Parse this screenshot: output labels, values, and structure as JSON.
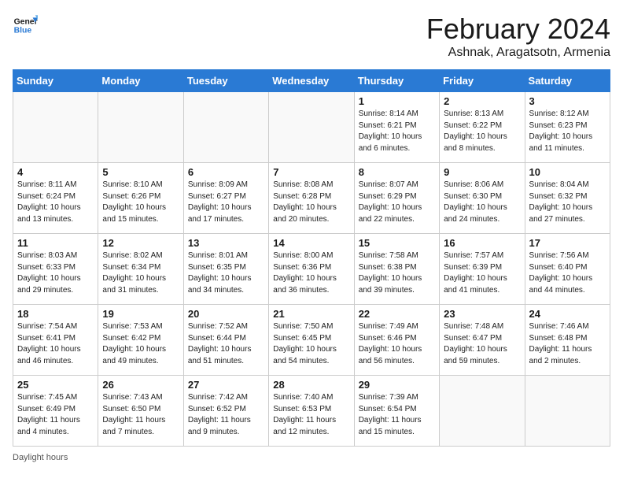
{
  "header": {
    "logo_line1": "General",
    "logo_line2": "Blue",
    "title": "February 2024",
    "subtitle": "Ashnak, Aragatsotn, Armenia"
  },
  "days_of_week": [
    "Sunday",
    "Monday",
    "Tuesday",
    "Wednesday",
    "Thursday",
    "Friday",
    "Saturday"
  ],
  "footer": {
    "daylight_label": "Daylight hours"
  },
  "weeks": [
    {
      "days": [
        {
          "num": "",
          "info": ""
        },
        {
          "num": "",
          "info": ""
        },
        {
          "num": "",
          "info": ""
        },
        {
          "num": "",
          "info": ""
        },
        {
          "num": "1",
          "info": "Sunrise: 8:14 AM\nSunset: 6:21 PM\nDaylight: 10 hours\nand 6 minutes."
        },
        {
          "num": "2",
          "info": "Sunrise: 8:13 AM\nSunset: 6:22 PM\nDaylight: 10 hours\nand 8 minutes."
        },
        {
          "num": "3",
          "info": "Sunrise: 8:12 AM\nSunset: 6:23 PM\nDaylight: 10 hours\nand 11 minutes."
        }
      ]
    },
    {
      "days": [
        {
          "num": "4",
          "info": "Sunrise: 8:11 AM\nSunset: 6:24 PM\nDaylight: 10 hours\nand 13 minutes."
        },
        {
          "num": "5",
          "info": "Sunrise: 8:10 AM\nSunset: 6:26 PM\nDaylight: 10 hours\nand 15 minutes."
        },
        {
          "num": "6",
          "info": "Sunrise: 8:09 AM\nSunset: 6:27 PM\nDaylight: 10 hours\nand 17 minutes."
        },
        {
          "num": "7",
          "info": "Sunrise: 8:08 AM\nSunset: 6:28 PM\nDaylight: 10 hours\nand 20 minutes."
        },
        {
          "num": "8",
          "info": "Sunrise: 8:07 AM\nSunset: 6:29 PM\nDaylight: 10 hours\nand 22 minutes."
        },
        {
          "num": "9",
          "info": "Sunrise: 8:06 AM\nSunset: 6:30 PM\nDaylight: 10 hours\nand 24 minutes."
        },
        {
          "num": "10",
          "info": "Sunrise: 8:04 AM\nSunset: 6:32 PM\nDaylight: 10 hours\nand 27 minutes."
        }
      ]
    },
    {
      "days": [
        {
          "num": "11",
          "info": "Sunrise: 8:03 AM\nSunset: 6:33 PM\nDaylight: 10 hours\nand 29 minutes."
        },
        {
          "num": "12",
          "info": "Sunrise: 8:02 AM\nSunset: 6:34 PM\nDaylight: 10 hours\nand 31 minutes."
        },
        {
          "num": "13",
          "info": "Sunrise: 8:01 AM\nSunset: 6:35 PM\nDaylight: 10 hours\nand 34 minutes."
        },
        {
          "num": "14",
          "info": "Sunrise: 8:00 AM\nSunset: 6:36 PM\nDaylight: 10 hours\nand 36 minutes."
        },
        {
          "num": "15",
          "info": "Sunrise: 7:58 AM\nSunset: 6:38 PM\nDaylight: 10 hours\nand 39 minutes."
        },
        {
          "num": "16",
          "info": "Sunrise: 7:57 AM\nSunset: 6:39 PM\nDaylight: 10 hours\nand 41 minutes."
        },
        {
          "num": "17",
          "info": "Sunrise: 7:56 AM\nSunset: 6:40 PM\nDaylight: 10 hours\nand 44 minutes."
        }
      ]
    },
    {
      "days": [
        {
          "num": "18",
          "info": "Sunrise: 7:54 AM\nSunset: 6:41 PM\nDaylight: 10 hours\nand 46 minutes."
        },
        {
          "num": "19",
          "info": "Sunrise: 7:53 AM\nSunset: 6:42 PM\nDaylight: 10 hours\nand 49 minutes."
        },
        {
          "num": "20",
          "info": "Sunrise: 7:52 AM\nSunset: 6:44 PM\nDaylight: 10 hours\nand 51 minutes."
        },
        {
          "num": "21",
          "info": "Sunrise: 7:50 AM\nSunset: 6:45 PM\nDaylight: 10 hours\nand 54 minutes."
        },
        {
          "num": "22",
          "info": "Sunrise: 7:49 AM\nSunset: 6:46 PM\nDaylight: 10 hours\nand 56 minutes."
        },
        {
          "num": "23",
          "info": "Sunrise: 7:48 AM\nSunset: 6:47 PM\nDaylight: 10 hours\nand 59 minutes."
        },
        {
          "num": "24",
          "info": "Sunrise: 7:46 AM\nSunset: 6:48 PM\nDaylight: 11 hours\nand 2 minutes."
        }
      ]
    },
    {
      "days": [
        {
          "num": "25",
          "info": "Sunrise: 7:45 AM\nSunset: 6:49 PM\nDaylight: 11 hours\nand 4 minutes."
        },
        {
          "num": "26",
          "info": "Sunrise: 7:43 AM\nSunset: 6:50 PM\nDaylight: 11 hours\nand 7 minutes."
        },
        {
          "num": "27",
          "info": "Sunrise: 7:42 AM\nSunset: 6:52 PM\nDaylight: 11 hours\nand 9 minutes."
        },
        {
          "num": "28",
          "info": "Sunrise: 7:40 AM\nSunset: 6:53 PM\nDaylight: 11 hours\nand 12 minutes."
        },
        {
          "num": "29",
          "info": "Sunrise: 7:39 AM\nSunset: 6:54 PM\nDaylight: 11 hours\nand 15 minutes."
        },
        {
          "num": "",
          "info": ""
        },
        {
          "num": "",
          "info": ""
        }
      ]
    }
  ]
}
